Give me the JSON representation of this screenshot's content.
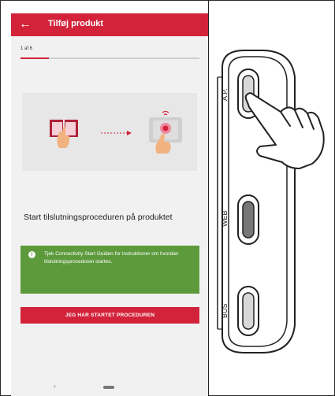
{
  "app": {
    "title": "Tilføj produkt",
    "step_label": "1 af 6",
    "progress_fraction": 0.16
  },
  "illustration": {
    "left_icon": "book-with-hand-icon",
    "right_icon": "device-touch-icon",
    "arrow_icon": "dashed-arrow-icon"
  },
  "main": {
    "heading": "Start tilslutningsproceduren på produktet"
  },
  "info_box": {
    "icon": "info-icon",
    "text": "Tjek Connectivity Start Guiden for instruktioner om hvordan tilslutningsproceduren startes."
  },
  "cta": {
    "label": "JEG HAR STARTET PROCEDUREN"
  },
  "device": {
    "buttons": [
      "A.P.",
      "WEB",
      "BUS"
    ]
  },
  "colors": {
    "accent": "#d2233a",
    "info_green": "#5d9a3c"
  }
}
